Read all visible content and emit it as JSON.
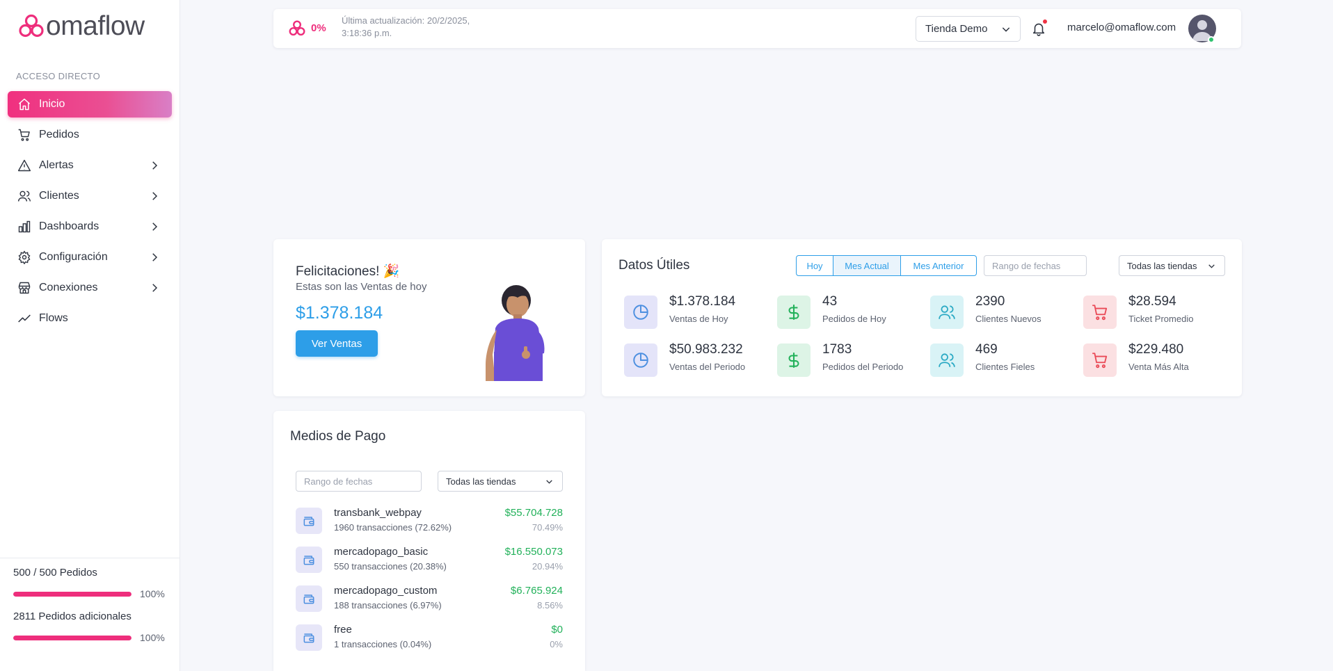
{
  "brand": {
    "name": "omaflow",
    "accent": "#ee2e7c"
  },
  "sidebar": {
    "section_label": "ACCESO DIRECTO",
    "items": [
      {
        "label": "Inicio",
        "icon": "home-icon",
        "active": true
      },
      {
        "label": "Pedidos",
        "icon": "cart-icon"
      },
      {
        "label": "Alertas",
        "icon": "warning-icon"
      },
      {
        "label": "Clientes",
        "icon": "users-icon"
      },
      {
        "label": "Dashboards",
        "icon": "bar-chart-icon"
      },
      {
        "label": "Configuración",
        "icon": "gear-icon"
      },
      {
        "label": "Conexiones",
        "icon": "store-icon"
      },
      {
        "label": "Flows",
        "icon": "trend-icon"
      }
    ],
    "usage": {
      "orders_label": "500 / 500 Pedidos",
      "orders_pct": "100%",
      "orders_fraction": 1.0,
      "extra_label": "2811 Pedidos adicionales",
      "extra_pct": "100%",
      "extra_fraction": 1.0
    }
  },
  "topbar": {
    "sync_pct": "0%",
    "last_update": "Última actualización: 20/2/2025, 3:18:36 p.m.",
    "store": "Tienda Demo",
    "user_email": "marcelo@omaflow.com"
  },
  "congrats": {
    "title": "Felicitaciones! 🎉",
    "subtitle": "Estas son las Ventas de hoy",
    "amount": "$1.378.184",
    "button": "Ver Ventas"
  },
  "datos": {
    "title": "Datos Útiles",
    "periods": [
      "Hoy",
      "Mes Actual",
      "Mes Anterior"
    ],
    "range_placeholder": "Rango de fechas",
    "stores_select": "Todas las tiendas",
    "stats": [
      {
        "value": "$1.378.184",
        "label": "Ventas de Hoy",
        "icon": "pie-chart-icon",
        "color": "purple"
      },
      {
        "value": "43",
        "label": "Pedidos de Hoy",
        "icon": "dollar-icon",
        "color": "green"
      },
      {
        "value": "2390",
        "label": "Clientes Nuevos",
        "icon": "users-icon",
        "color": "cyan"
      },
      {
        "value": "$28.594",
        "label": "Ticket Promedio",
        "icon": "cart-icon",
        "color": "red"
      },
      {
        "value": "$50.983.232",
        "label": "Ventas del Periodo",
        "icon": "pie-chart-icon",
        "color": "purple"
      },
      {
        "value": "1783",
        "label": "Pedidos del Periodo",
        "icon": "dollar-icon",
        "color": "green"
      },
      {
        "value": "469",
        "label": "Clientes Fieles",
        "icon": "users-icon",
        "color": "cyan"
      },
      {
        "value": "$229.480",
        "label": "Venta Más Alta",
        "icon": "cart-icon",
        "color": "red"
      }
    ]
  },
  "medios": {
    "title": "Medios de Pago",
    "range_placeholder": "Rango de fechas",
    "stores_select": "Todas las tiendas",
    "rows": [
      {
        "name": "transbank_webpay",
        "tx": "1960 transacciones (72.62%)",
        "amount": "$55.704.728",
        "share": "70.49%"
      },
      {
        "name": "mercadopago_basic",
        "tx": "550 transacciones (20.38%)",
        "amount": "$16.550.073",
        "share": "20.94%"
      },
      {
        "name": "mercadopago_custom",
        "tx": "188 transacciones (6.97%)",
        "amount": "$6.765.924",
        "share": "8.56%"
      },
      {
        "name": "free",
        "tx": "1 transacciones (0.04%)",
        "amount": "$0",
        "share": "0%"
      }
    ]
  }
}
